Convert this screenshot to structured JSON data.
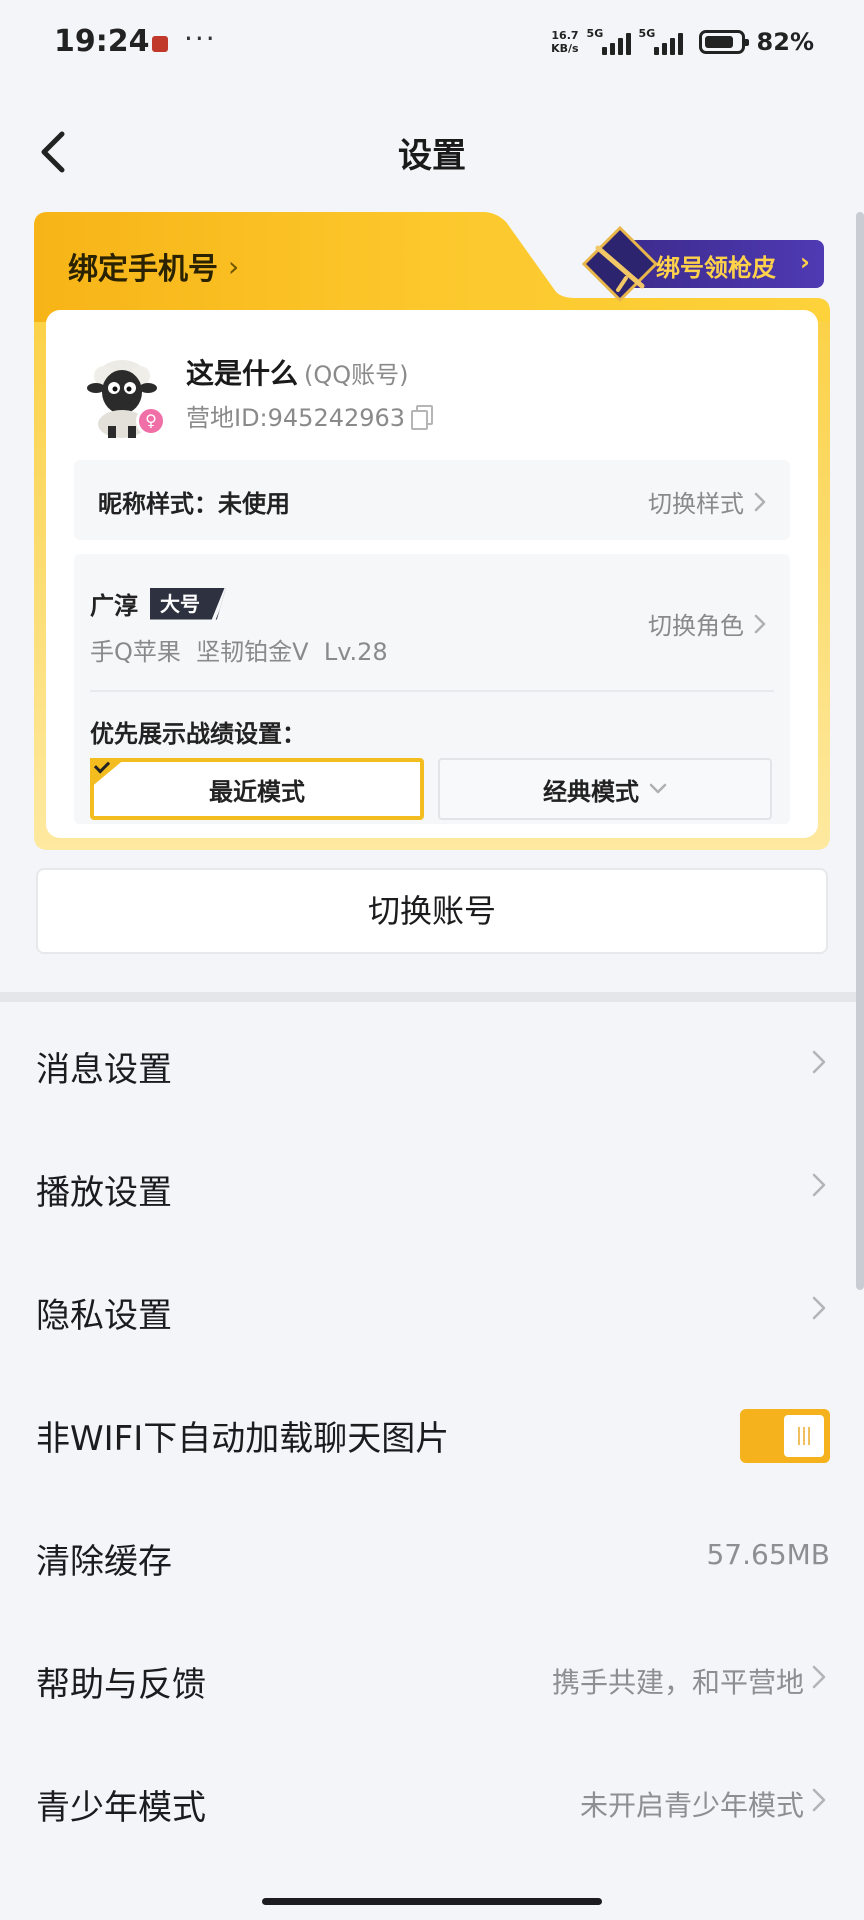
{
  "status_bar": {
    "time": "19:24",
    "net_speed_value": "16.7",
    "net_speed_unit": "KB/s",
    "network_1": "5G",
    "network_2": "5G",
    "battery_percent": "82%",
    "battery_level": 0.82,
    "overflow": "···"
  },
  "nav": {
    "back_icon": "chevron-left-icon",
    "title": "设置"
  },
  "account_card": {
    "bind_phone_label": "绑定手机号",
    "promo_label": "绑号领枪皮",
    "promo_icon": "gun-skin-icon",
    "user": {
      "name": "这是什么",
      "account_type": "(QQ账号)",
      "camp_id": "营地ID:945242963",
      "gender_symbol": "♀",
      "avatar_icon": "sheep-avatar-icon"
    },
    "nickname": {
      "label": "昵称样式：未使用",
      "action": "切换样式"
    },
    "role": {
      "name": "广淳",
      "tag": "大号",
      "info": "手Q苹果  坚韧铂金Ⅴ  Lv.28",
      "action": "切换角色"
    },
    "record_pref": {
      "label": "优先展示战绩设置：",
      "options": [
        "最近模式",
        "经典模式"
      ],
      "selected": "最近模式"
    }
  },
  "switch_account_label": "切换账号",
  "settings": {
    "items": [
      {
        "label": "消息设置",
        "value": ""
      },
      {
        "label": "播放设置",
        "value": ""
      },
      {
        "label": "隐私设置",
        "value": ""
      },
      {
        "label": "非WIFI下自动加载聊天图片",
        "toggle": true
      },
      {
        "label": "清除缓存",
        "value": "57.65MB"
      },
      {
        "label": "帮助与反馈",
        "value": "携手共建，和平营地"
      },
      {
        "label": "青少年模式",
        "value": "未开启青少年模式"
      }
    ]
  },
  "colors": {
    "accent": "#f6b21c",
    "card_gold": "#fcc72c",
    "promo_bg": "#3b2a8a",
    "background": "#f3f5f8"
  }
}
